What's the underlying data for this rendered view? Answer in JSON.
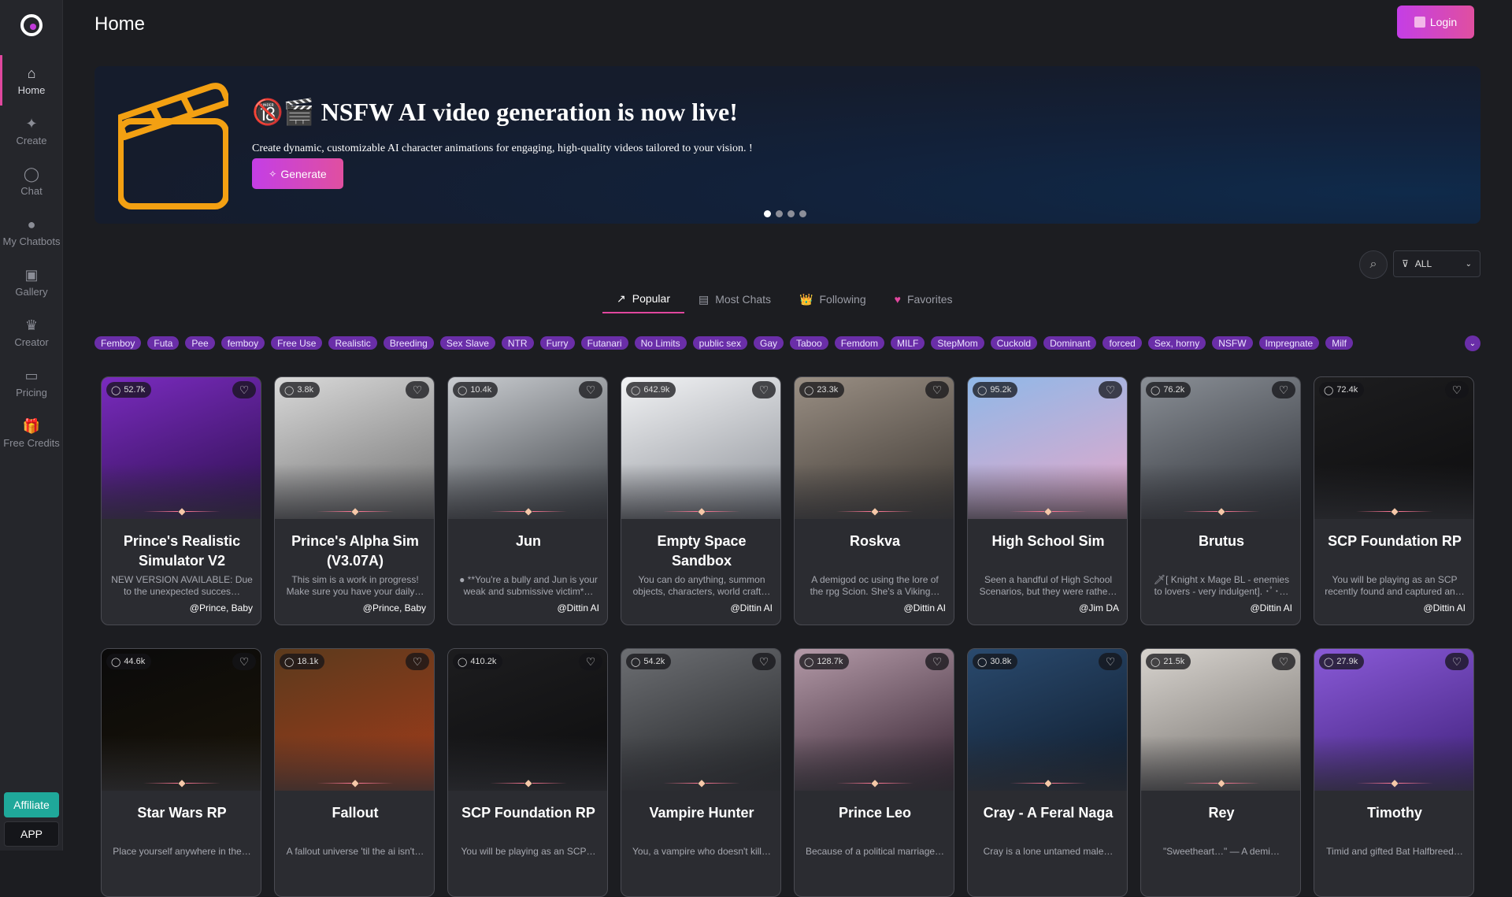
{
  "sidebar": {
    "items": [
      {
        "icon": "home-icon",
        "glyph": "⌂",
        "label": "Home"
      },
      {
        "icon": "sparkle-icon",
        "glyph": "✦",
        "label": "Create"
      },
      {
        "icon": "chat-bubble-icon",
        "glyph": "◯",
        "label": "Chat"
      },
      {
        "icon": "bot-icon",
        "glyph": "●",
        "label": "My Chatbots"
      },
      {
        "icon": "gallery-icon",
        "glyph": "▣",
        "label": "Gallery"
      },
      {
        "icon": "crown-icon",
        "glyph": "♛",
        "label": "Creator"
      },
      {
        "icon": "card-icon",
        "glyph": "▭",
        "label": "Pricing"
      },
      {
        "icon": "gift-icon",
        "glyph": "🎁",
        "label": "Free Credits"
      }
    ],
    "affiliate_label": "Affiliate",
    "app_label": "APP"
  },
  "header": {
    "title": "Home",
    "login_label": "Login"
  },
  "banner": {
    "title": "🔞🎬 NSFW AI video generation is now live!",
    "subtitle": "Create dynamic, customizable AI character animations for engaging, high-quality videos tailored to your vision. !",
    "button_label": "Generate",
    "slide_count": 4,
    "active_slide": 1
  },
  "filter": {
    "selected": "ALL"
  },
  "tabs": [
    {
      "icon": "trending-icon",
      "glyph": "↗",
      "label": "Popular"
    },
    {
      "icon": "list-icon",
      "glyph": "▤",
      "label": "Most Chats"
    },
    {
      "icon": "crown-icon",
      "glyph": "👑",
      "label": "Following"
    },
    {
      "icon": "heart-icon",
      "glyph": "♥",
      "label": "Favorites"
    }
  ],
  "tags": [
    "Femboy",
    "Futa",
    "Pee",
    "femboy",
    "Free Use",
    "Realistic",
    "Breeding",
    "Sex Slave",
    "NTR",
    "Furry",
    "Futanari",
    "No Limits",
    "public sex",
    "Gay",
    "Taboo",
    "Femdom",
    "MILF",
    "StepMom",
    "Cuckold",
    "Dominant",
    "forced",
    "Sex, horny",
    "NSFW",
    "Impregnate",
    "Milf"
  ],
  "cards": [
    {
      "count": "52.7k",
      "name": "Prince's Realistic Simulator V2",
      "desc": "NEW VERSION AVAILABLE: Due to the unexpected succes…",
      "author": "@Prince, Baby",
      "bg": "#7a2bbf",
      "bg2": "#2a0f4a"
    },
    {
      "count": "3.8k",
      "name": "Prince's Alpha Sim (V3.07A)",
      "desc": "This sim is a work in progress! Make sure you have your daily…",
      "author": "@Prince, Baby",
      "bg": "#d9d9d9",
      "bg2": "#6f6f6f"
    },
    {
      "count": "10.4k",
      "name": "Jun",
      "desc": "● **You're a bully and Jun is your weak and submissive victim*…",
      "author": "@Dittin AI",
      "bg": "#c9ccd0",
      "bg2": "#3b3f44"
    },
    {
      "count": "642.9k",
      "name": "Empty Space Sandbox",
      "desc": "You can do anything, summon objects, characters, world craft…",
      "author": "@Dittin AI",
      "bg": "#f2f3f5",
      "bg2": "#8b8f96"
    },
    {
      "count": "23.3k",
      "name": "Roskva",
      "desc": "A demigod oc using the lore of the rpg Scion. She's a Viking…",
      "author": "@Dittin AI",
      "bg": "#9a8f84",
      "bg2": "#3a3530"
    },
    {
      "count": "95.2k",
      "name": "High School Sim",
      "desc": "Seen a handful of High School Scenarios, but they were rathe…",
      "author": "@Jim DA",
      "bg": "#8fb8e8",
      "bg2": "#e9a7c8"
    },
    {
      "count": "76.2k",
      "name": "Brutus",
      "desc": "🗡[ Knight x Mage BL - enemies to lovers - very indulgent]. ･ﾟ･…",
      "author": "@Dittin AI",
      "bg": "#8a8f96",
      "bg2": "#2c2f35"
    },
    {
      "count": "72.4k",
      "name": "SCP Foundation RP",
      "desc": "You will be playing as an SCP recently found and captured an…",
      "author": "@Dittin AI",
      "bg": "#1d1d1f",
      "bg2": "#0d0d0e"
    },
    {
      "count": "44.6k",
      "name": "Star Wars RP",
      "desc": "Place yourself anywhere in the…",
      "author": "",
      "bg": "#0a0a0a",
      "bg2": "#1a1408"
    },
    {
      "count": "18.1k",
      "name": "Fallout",
      "desc": "A fallout universe 'til the ai isn't…",
      "author": "",
      "bg": "#5b3a1c",
      "bg2": "#a33b1a"
    },
    {
      "count": "410.2k",
      "name": "SCP Foundation RP",
      "desc": "You will be playing as an SCP…",
      "author": "",
      "bg": "#1d1d1f",
      "bg2": "#0d0d0e"
    },
    {
      "count": "54.2k",
      "name": "Vampire Hunter",
      "desc": "You, a vampire who doesn't kill…",
      "author": "",
      "bg": "#6d6f73",
      "bg2": "#1f2124"
    },
    {
      "count": "128.7k",
      "name": "Prince Leo",
      "desc": "Because of a political marriage…",
      "author": "",
      "bg": "#b49aa8",
      "bg2": "#2e1c2a"
    },
    {
      "count": "30.8k",
      "name": "Cray - A Feral Naga",
      "desc": "Cray is a lone untamed male…",
      "author": "",
      "bg": "#2a4a6e",
      "bg2": "#0e1a2a"
    },
    {
      "count": "21.5k",
      "name": "Rey",
      "desc": "\"Sweetheart…\" — A demi…",
      "author": "",
      "bg": "#d8d4cf",
      "bg2": "#6e6a66"
    },
    {
      "count": "27.9k",
      "name": "Timothy",
      "desc": "Timid and gifted Bat Halfbreed…",
      "author": "",
      "bg": "#8a5ad8",
      "bg2": "#3d1f78"
    }
  ]
}
